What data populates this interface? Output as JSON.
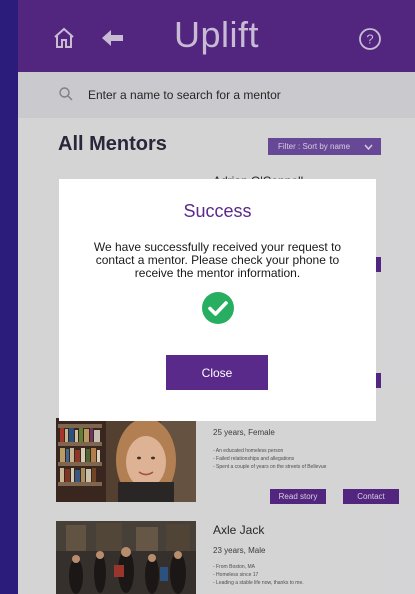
{
  "app": {
    "title": "Uplift"
  },
  "search": {
    "placeholder": "Enter a name to search for a mentor"
  },
  "main": {
    "section_title": "All Mentors",
    "filter_label": "Filter : Sort by name"
  },
  "mentors": [
    {
      "name": "Adrian O'Connell",
      "meta": "",
      "bullets": []
    },
    {
      "name": "",
      "meta": "25 years, Female",
      "bullets": [
        "- An educated homeless person",
        "- Failed relationships and allegations",
        "- Spent a couple of years on the streets of Bellevue"
      ],
      "read_story": "Read story",
      "contact": "Contact"
    },
    {
      "name": "Axle Jack",
      "meta": "23 years, Male",
      "bullets": [
        "- From Boston, MA",
        "- Homeless since 17",
        "- Leading a stable life now, thanks to me."
      ]
    }
  ],
  "modal": {
    "title": "Success",
    "message": "We have successfully received your request to contact a mentor. Please check your phone to receive the mentor information.",
    "close_label": "Close"
  },
  "colors": {
    "header": "#5a2a8a",
    "accent": "#5a2a8a",
    "success": "#27ae60",
    "background": "#2b1b7a"
  },
  "icons": {
    "home": "home-icon",
    "back": "back-arrow-icon",
    "help": "help-icon",
    "search": "search-icon",
    "check": "check-circle-icon",
    "dropdown": "chevron-down-icon"
  }
}
